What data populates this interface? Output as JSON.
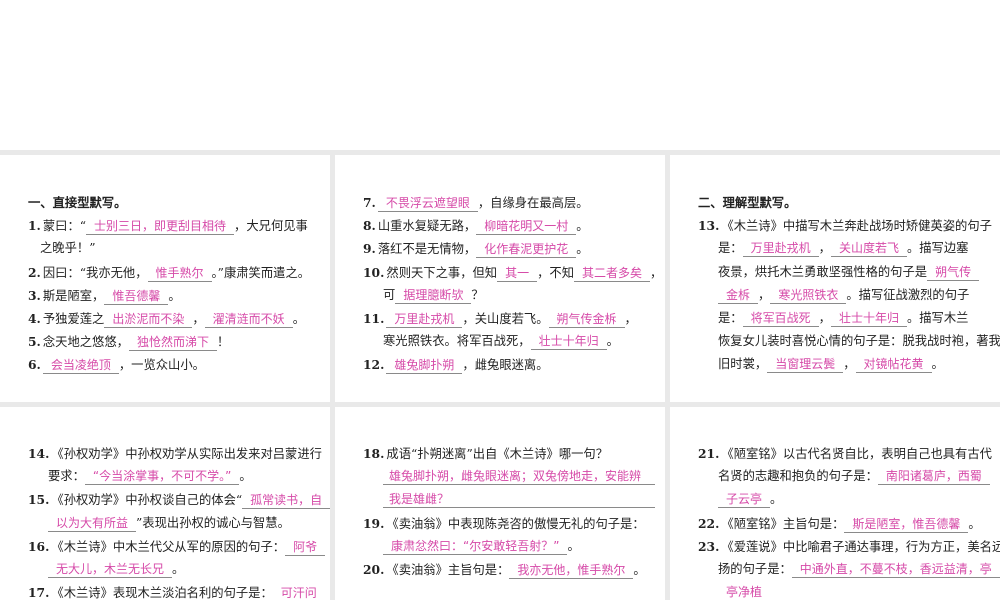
{
  "panels": [
    {
      "lines": [
        {
          "heading": "一、直接型默写。"
        },
        {
          "num": "1.",
          "segs": [
            {
              "t": "蒙曰：“"
            },
            {
              "b": "士别三日，即更刮目相待"
            },
            {
              "t": "，大兄何见事"
            }
          ]
        },
        {
          "cont": true,
          "segs": [
            {
              "t": "之晚乎！”"
            }
          ]
        },
        {
          "num": "2.",
          "segs": [
            {
              "t": "因曰：“我亦无他，"
            },
            {
              "b": "惟手熟尔"
            },
            {
              "t": "。”康肃笑而遣之。"
            }
          ]
        },
        {
          "num": "3.",
          "segs": [
            {
              "t": "斯是陋室，"
            },
            {
              "b": "惟吾德馨"
            },
            {
              "t": "。"
            }
          ]
        },
        {
          "num": "4.",
          "segs": [
            {
              "t": "予独爱莲之"
            },
            {
              "b": "出淤泥而不染"
            },
            {
              "t": "，"
            },
            {
              "b": "濯清涟而不妖"
            },
            {
              "t": "。"
            }
          ]
        },
        {
          "num": "5.",
          "segs": [
            {
              "t": "念天地之悠悠，"
            },
            {
              "b": "独怆然而涕下"
            },
            {
              "t": "！"
            }
          ]
        },
        {
          "num": "6.",
          "segs": [
            {
              "b": "会当凌绝顶"
            },
            {
              "t": "，一览众山小。"
            }
          ]
        }
      ]
    },
    {
      "lines": [
        {
          "num": "7.",
          "segs": [
            {
              "b": "不畏浮云遮望眼"
            },
            {
              "t": "，自缘身在最高层。"
            }
          ]
        },
        {
          "num": "8.",
          "segs": [
            {
              "t": "山重水复疑无路，"
            },
            {
              "b": "柳暗花明又一村"
            },
            {
              "t": "。"
            }
          ]
        },
        {
          "num": "9.",
          "segs": [
            {
              "t": "落红不是无情物，"
            },
            {
              "b": "化作春泥更护花"
            },
            {
              "t": "。"
            }
          ]
        },
        {
          "num": "10.",
          "segs": [
            {
              "t": "然则天下之事，但知"
            },
            {
              "b": "其一"
            },
            {
              "t": "，不知"
            },
            {
              "b": "其二者多矣"
            },
            {
              "t": "，"
            }
          ]
        },
        {
          "cont": true,
          "segs": [
            {
              "t": "可"
            },
            {
              "b": "据理臆断欤"
            },
            {
              "t": "？"
            }
          ]
        },
        {
          "num": "11.",
          "segs": [
            {
              "b": "万里赴戎机"
            },
            {
              "t": "，关山度若飞。"
            },
            {
              "b": "朔气传金柝"
            },
            {
              "t": "，"
            }
          ]
        },
        {
          "cont": true,
          "segs": [
            {
              "t": "寒光照铁衣。将军百战死，"
            },
            {
              "b": "壮士十年归"
            },
            {
              "t": "。"
            }
          ]
        },
        {
          "num": "12.",
          "segs": [
            {
              "b": "雄兔脚扑朔"
            },
            {
              "t": "，雌兔眼迷离。"
            }
          ]
        }
      ]
    },
    {
      "lines": [
        {
          "heading": "二、理解型默写。"
        },
        {
          "num": "13.",
          "segs": [
            {
              "t": "《木兰诗》中描写木兰奔赴战场时矫健英姿的句子"
            }
          ]
        },
        {
          "cont": true,
          "segs": [
            {
              "t": "是："
            },
            {
              "b": "万里赴戎机"
            },
            {
              "t": "，"
            },
            {
              "b": "关山度若飞"
            },
            {
              "t": "。描写边塞"
            }
          ]
        },
        {
          "cont": true,
          "segs": [
            {
              "t": "夜景，烘托木兰勇敢坚强性格的句子是"
            },
            {
              "b": "朔气传"
            }
          ]
        },
        {
          "cont": true,
          "segs": [
            {
              "b": "金柝"
            },
            {
              "t": "，"
            },
            {
              "b": "寒光照铁衣"
            },
            {
              "t": "。描写征战激烈的句子"
            }
          ]
        },
        {
          "cont": true,
          "segs": [
            {
              "t": "是："
            },
            {
              "b": "将军百战死"
            },
            {
              "t": "，"
            },
            {
              "b": "壮士十年归"
            },
            {
              "t": "。描写木兰"
            }
          ]
        },
        {
          "cont": true,
          "segs": [
            {
              "t": "恢复女儿装时喜悦心情的句子是：脱我战时袍，著我"
            }
          ]
        },
        {
          "cont": true,
          "segs": [
            {
              "t": "旧时裳，"
            },
            {
              "b": "当窗理云鬓"
            },
            {
              "t": "，"
            },
            {
              "b": "对镜帖花黄"
            },
            {
              "t": "。"
            }
          ]
        }
      ]
    },
    {
      "lines": [
        {
          "num": "14.",
          "segs": [
            {
              "t": "《孙权劝学》中孙权劝学从实际出发来对吕蒙进行"
            }
          ]
        },
        {
          "cont": true,
          "segs": [
            {
              "t": "要求："
            },
            {
              "b": "“今当涂掌事，不可不学。”"
            },
            {
              "t": "。"
            }
          ]
        },
        {
          "num": "15.",
          "segs": [
            {
              "t": "《孙权劝学》中孙权谈自己的体会“"
            },
            {
              "b": "孤常读书，自"
            }
          ]
        },
        {
          "cont": true,
          "segs": [
            {
              "b": "以为大有所益"
            },
            {
              "t": "”表现出孙权的诚心与智慧。"
            }
          ]
        },
        {
          "num": "16.",
          "segs": [
            {
              "t": "《木兰诗》中木兰代父从军的原因的句子："
            },
            {
              "b": "阿爷"
            }
          ]
        },
        {
          "cont": true,
          "segs": [
            {
              "b": "无大儿，木兰无长兄"
            },
            {
              "t": "。"
            }
          ]
        },
        {
          "num": "17.",
          "segs": [
            {
              "t": "《木兰诗》表现木兰淡泊名利的句子是："
            },
            {
              "b": "可汗问"
            }
          ]
        }
      ]
    },
    {
      "lines": [
        {
          "num": "18.",
          "segs": [
            {
              "t": "成语“扑朔迷离”出自《木兰诗》哪一句？"
            }
          ]
        },
        {
          "cont": true,
          "segs": [
            {
              "b": "雄兔脚扑朔，雌兔眼迷离；双兔傍地走，安能辨",
              "full": true
            }
          ]
        },
        {
          "cont": true,
          "segs": [
            {
              "b": "我是雄雌？",
              "full": true
            }
          ]
        },
        {
          "num": "19.",
          "segs": [
            {
              "t": "《卖油翁》中表现陈尧咨的傲慢无礼的句子是："
            }
          ]
        },
        {
          "cont": true,
          "segs": [
            {
              "b": "康肃忿然曰：“尔安敢轻吾射？”"
            },
            {
              "t": "。"
            }
          ]
        },
        {
          "num": "20.",
          "segs": [
            {
              "t": "《卖油翁》主旨句是："
            },
            {
              "b": "我亦无他，惟手熟尔"
            },
            {
              "t": "。"
            }
          ]
        }
      ]
    },
    {
      "lines": [
        {
          "num": "21.",
          "segs": [
            {
              "t": "《陋室铭》以古代名贤自比，表明自己也具有古代"
            }
          ]
        },
        {
          "cont": true,
          "segs": [
            {
              "t": "名贤的志趣和抱负的句子是："
            },
            {
              "b": "南阳诸葛庐，西蜀"
            }
          ]
        },
        {
          "cont": true,
          "segs": [
            {
              "b": "子云亭"
            },
            {
              "t": "。"
            }
          ]
        },
        {
          "num": "22.",
          "segs": [
            {
              "t": "《陋室铭》主旨句是："
            },
            {
              "b": "斯是陋室，惟吾德馨"
            },
            {
              "t": "。"
            }
          ]
        },
        {
          "num": "23.",
          "segs": [
            {
              "t": "《爱莲说》中比喻君子通达事理，行为方正，美名远"
            }
          ]
        },
        {
          "cont": true,
          "segs": [
            {
              "t": "扬的句子是："
            },
            {
              "b": "中通外直，不蔓不枝，香远益清，亭"
            }
          ]
        },
        {
          "cont": true,
          "segs": [
            {
              "b": "亭净植"
            }
          ]
        }
      ]
    }
  ]
}
